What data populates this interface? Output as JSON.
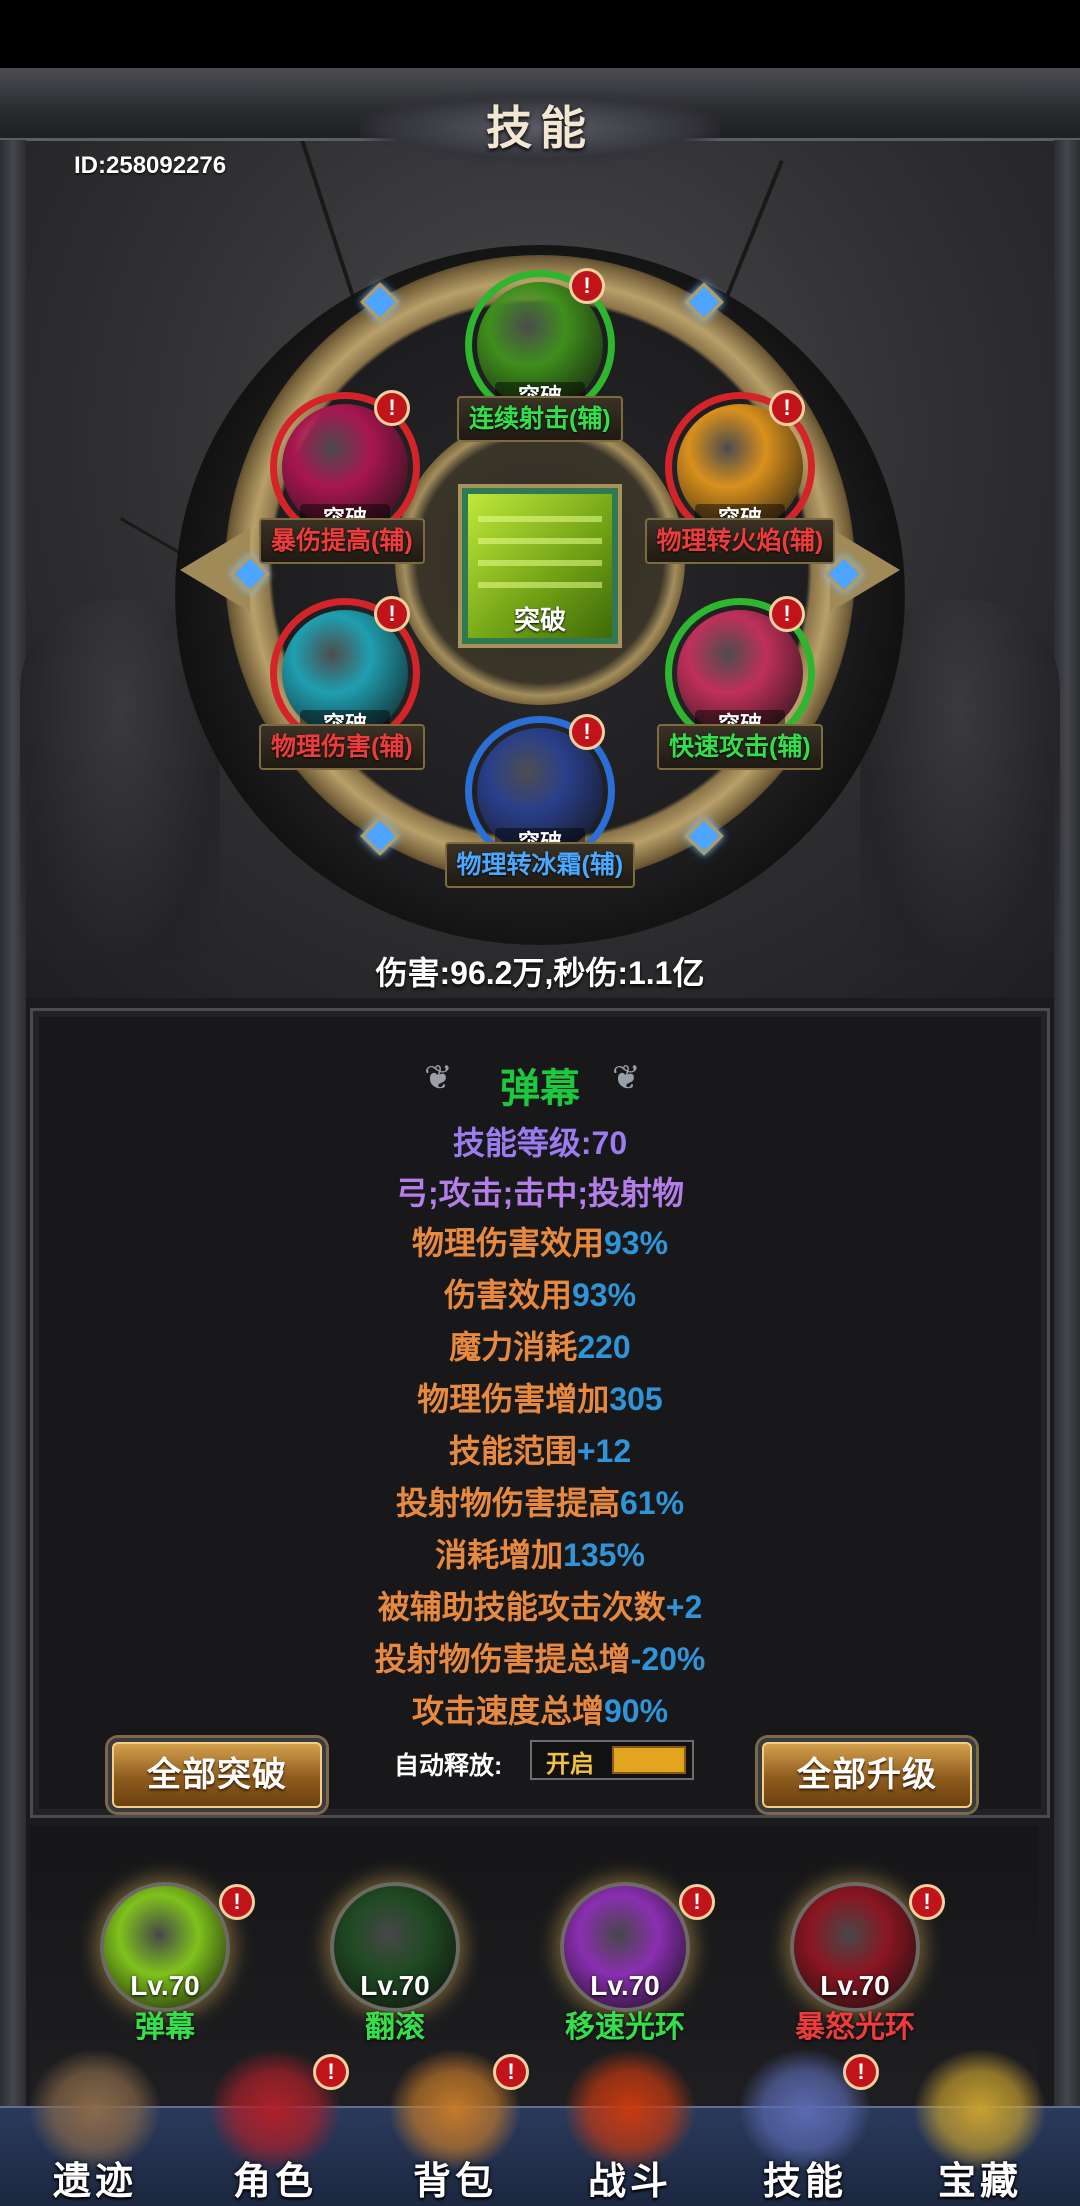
{
  "header": {
    "title": "技能",
    "id_text": "ID:258092276"
  },
  "wheel": {
    "center": {
      "badge": "突破"
    },
    "slots": [
      {
        "label": "连续射击(辅)",
        "badge": "突破",
        "alert": "!",
        "ring_color": "#2eb62e",
        "label_color": "#33e04a",
        "art_color": "#3f8f1c",
        "icon": "arrow-volley-icon"
      },
      {
        "label": "暴伤提高(辅)",
        "badge": "突破",
        "alert": "!",
        "ring_color": "#d4242a",
        "label_color": "#ee3b3b",
        "art_color": "#a81650",
        "icon": "crit-damage-icon"
      },
      {
        "label": "物理转火焰(辅)",
        "badge": "突破",
        "alert": "!",
        "ring_color": "#d4242a",
        "label_color": "#ee3b3b",
        "art_color": "#d9901c",
        "icon": "fire-conversion-icon"
      },
      {
        "label": "物理伤害(辅)",
        "badge": "突破",
        "alert": "!",
        "ring_color": "#d4242a",
        "label_color": "#ee3b3b",
        "art_color": "#1f9fb0",
        "icon": "physical-damage-icon"
      },
      {
        "label": "快速攻击(辅)",
        "badge": "突破",
        "alert": "!",
        "ring_color": "#2eb62e",
        "label_color": "#33e04a",
        "art_color": "#c0305a",
        "icon": "fast-attack-icon"
      },
      {
        "label": "物理转冰霜(辅)",
        "badge": "突破",
        "alert": "!",
        "ring_color": "#2a6fd6",
        "label_color": "#4aa8ff",
        "art_color": "#2a3f8a",
        "icon": "frost-conversion-icon"
      }
    ]
  },
  "damage_line": "伤害:96.2万,秒伤:1.1亿",
  "detail": {
    "name": "弹幕",
    "level": "技能等级:70",
    "tags": "弓;攻击;击中;投射物",
    "attrs": [
      {
        "label": "物理伤害效用",
        "value": "93%"
      },
      {
        "label": "伤害效用",
        "value": "93%"
      },
      {
        "label": "魔力消耗",
        "value": "220"
      },
      {
        "label": "物理伤害增加",
        "value": "305"
      },
      {
        "label": "技能范围",
        "value": "+12"
      },
      {
        "label": "投射物伤害提高",
        "value": "61%"
      },
      {
        "label": "消耗增加",
        "value": "135%"
      },
      {
        "label": "被辅助技能攻击次数",
        "value": "+2"
      },
      {
        "label": "投射物伤害提总增",
        "value": "-20%"
      },
      {
        "label": "攻击速度总增",
        "value": "90%"
      }
    ]
  },
  "actions": {
    "break_all": "全部突破",
    "auto_label": "自动释放:",
    "auto_state": "开启",
    "upgrade_all": "全部升级"
  },
  "skillbar": [
    {
      "level": "Lv.70",
      "name": "弹幕",
      "name_color": "#33e04a",
      "art_color": "#7fc21c",
      "alert": "!",
      "icon": "barrage-icon"
    },
    {
      "level": "Lv.70",
      "name": "翻滚",
      "name_color": "#33e04a",
      "art_color": "#1f4a22",
      "alert": "",
      "icon": "roll-icon"
    },
    {
      "level": "Lv.70",
      "name": "移速光环",
      "name_color": "#33e04a",
      "art_color": "#8a2fb0",
      "alert": "!",
      "icon": "speed-aura-icon"
    },
    {
      "level": "Lv.70",
      "name": "暴怒光环",
      "name_color": "#ee3b3b",
      "art_color": "#8a1622",
      "alert": "!",
      "icon": "rage-aura-icon"
    }
  ],
  "nav": [
    {
      "label": "遗迹",
      "icon": "relic-icon",
      "color": "#8a6a4a",
      "alert": ""
    },
    {
      "label": "角色",
      "icon": "character-icon",
      "color": "#b0202a",
      "alert": "!"
    },
    {
      "label": "背包",
      "icon": "backpack-icon",
      "color": "#c47a2a",
      "alert": "!"
    },
    {
      "label": "战斗",
      "icon": "battle-icon",
      "color": "#c83a10",
      "alert": ""
    },
    {
      "label": "技能",
      "icon": "skill-book-icon",
      "color": "#5a6ab0",
      "alert": "!"
    },
    {
      "label": "宝藏",
      "icon": "treasure-icon",
      "color": "#c8a030",
      "alert": ""
    }
  ]
}
